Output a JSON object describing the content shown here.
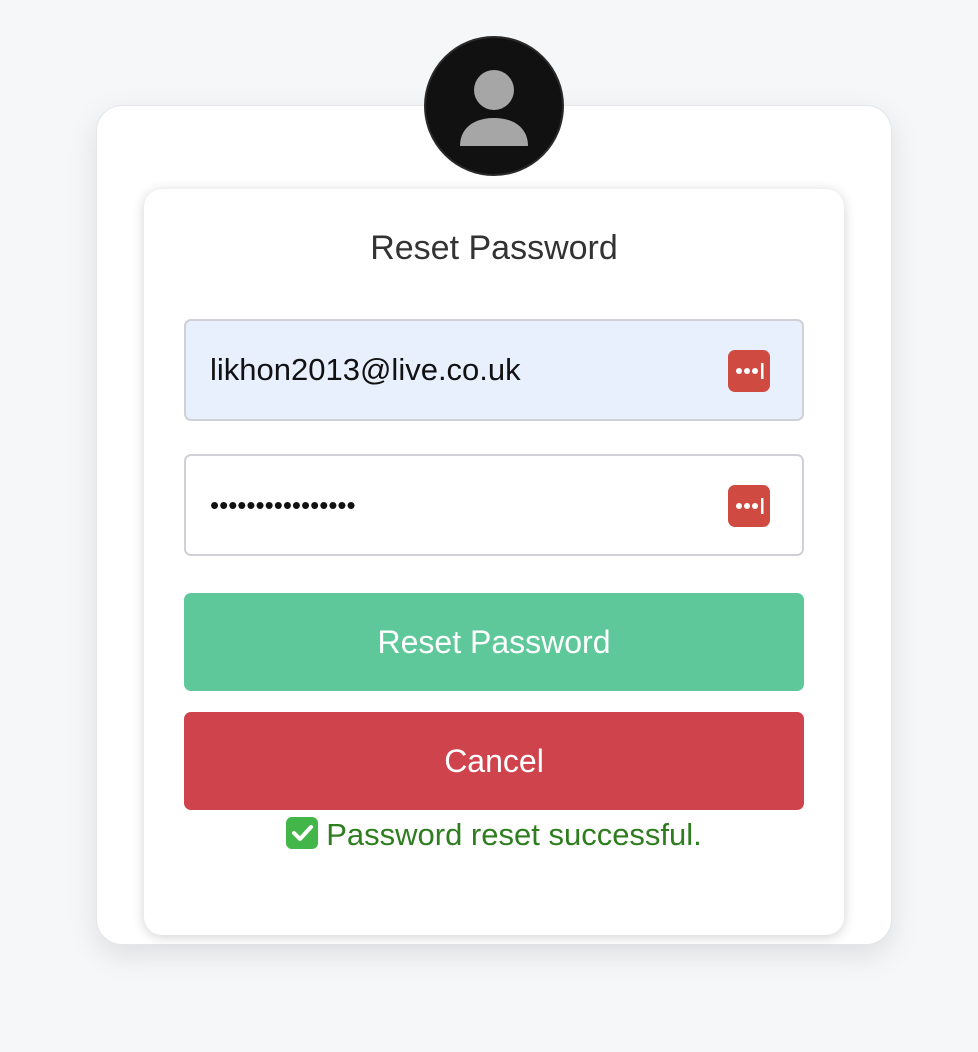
{
  "form": {
    "title": "Reset Password",
    "email_value": "likhon2013@live.co.uk",
    "password_masked": "••••••••••••••••",
    "password_manager_icon": "password-manager-icon",
    "reset_button_label": "Reset Password",
    "cancel_button_label": "Cancel",
    "status_message": "Password reset successful.",
    "status_icon": "check-mark-icon"
  },
  "avatar": {
    "icon": "user-icon"
  },
  "colors": {
    "email_field_bg": "#e8f0fe",
    "reset_button": "#5fc89b",
    "cancel_button": "#cf434c",
    "status_text": "#2e7d1f",
    "password_manager_icon": "#cf4a41"
  }
}
